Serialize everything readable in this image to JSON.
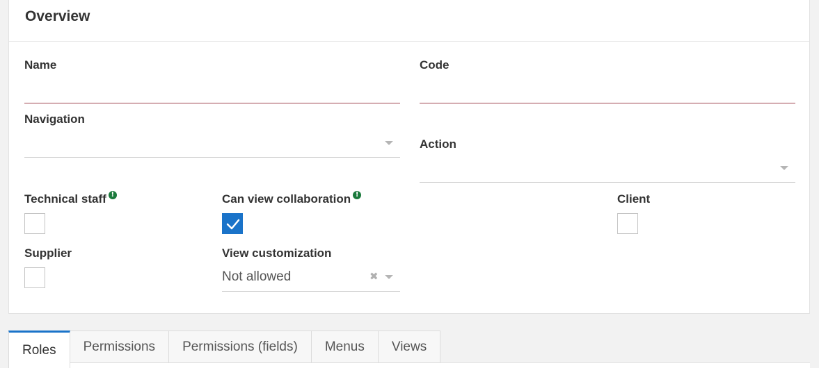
{
  "panel": {
    "title": "Overview"
  },
  "fields": {
    "name": {
      "label": "Name",
      "value": ""
    },
    "code": {
      "label": "Code",
      "value": ""
    },
    "navigation": {
      "label": "Navigation",
      "value": ""
    },
    "action": {
      "label": "Action",
      "value": ""
    },
    "technical_staff": {
      "label": "Technical staff",
      "checked": false
    },
    "can_view_collaboration": {
      "label": "Can view collaboration",
      "checked": true
    },
    "client": {
      "label": "Client",
      "checked": false
    },
    "supplier": {
      "label": "Supplier",
      "checked": false
    },
    "view_customization": {
      "label": "View customization",
      "value": "Not allowed"
    }
  },
  "info_icon_glyph": "!",
  "colors": {
    "accent": "#1a73c9",
    "required_line": "#a0444f",
    "info": "#1b7a3c"
  },
  "tabs": [
    {
      "label": "Roles",
      "active": true
    },
    {
      "label": "Permissions",
      "active": false
    },
    {
      "label": "Permissions (fields)",
      "active": false
    },
    {
      "label": "Menus",
      "active": false
    },
    {
      "label": "Views",
      "active": false
    }
  ]
}
